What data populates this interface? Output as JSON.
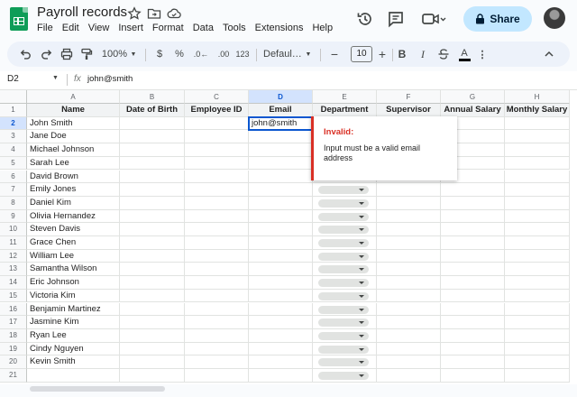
{
  "app": {
    "title": "Payroll records",
    "menu": [
      "File",
      "Edit",
      "View",
      "Insert",
      "Format",
      "Data",
      "Tools",
      "Extensions",
      "Help"
    ],
    "share_label": "Share"
  },
  "toolbar": {
    "zoom": "100%",
    "currency": "$",
    "percent": "%",
    "decimal_dec": ".0←",
    "decimal_inc": ".00",
    "number_format": "123",
    "font": "Defaul…",
    "minus": "−",
    "font_size": "10",
    "plus": "+",
    "bold": "B",
    "italic": "I",
    "text_color_label": "A"
  },
  "formula_bar": {
    "cell_ref": "D2",
    "fx": "fx",
    "value": "john@smith"
  },
  "sheet": {
    "columns": [
      "A",
      "B",
      "C",
      "D",
      "E",
      "F",
      "G",
      "H"
    ],
    "selected_column": "D",
    "selected_row": 2,
    "headers": [
      "Name",
      "Date of Birth",
      "Employee ID",
      "Email",
      "Department",
      "Supervisor",
      "Annual Salary",
      "Monthly Salary"
    ],
    "row_numbers": [
      "1",
      "2",
      "3",
      "4",
      "5",
      "6",
      "7",
      "8",
      "9",
      "10",
      "11",
      "12",
      "13",
      "14",
      "15",
      "16",
      "17",
      "18",
      "19",
      "20",
      "21"
    ],
    "names": [
      "John Smith",
      "Jane Doe",
      "Michael Johnson",
      "Sarah Lee",
      "David Brown",
      "Emily Jones",
      "Daniel Kim",
      "Olivia Hernandez",
      "Steven Davis",
      "Grace Chen",
      "William Lee",
      "Samantha Wilson",
      "Eric Johnson",
      "Victoria Kim",
      "Benjamin Martinez",
      "Jasmine Kim",
      "Ryan Lee",
      "Cindy Nguyen",
      "Kevin Smith"
    ],
    "email_value": "john@smith"
  },
  "validation_popup": {
    "title": "Invalid:",
    "message": "Input must be a valid email address"
  },
  "colors": {
    "accent": "#0b57d0",
    "error": "#d93025",
    "share_bg": "#c2e7ff",
    "sheets_green": "#0f9d58"
  }
}
